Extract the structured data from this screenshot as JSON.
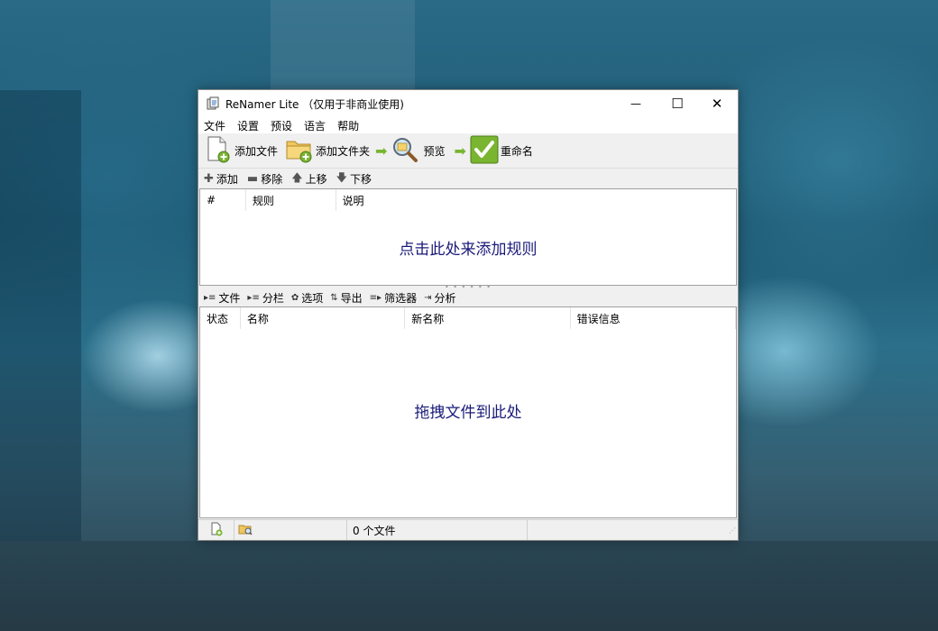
{
  "window": {
    "title": "ReNamer Lite （仅用于非商业使用)",
    "controls": {
      "minimize": "—",
      "maximize": "☐",
      "close": "✕"
    }
  },
  "menu": [
    "文件",
    "设置",
    "预设",
    "语言",
    "帮助"
  ],
  "toolbar": {
    "add_files": "添加文件",
    "add_folders": "添加文件夹",
    "preview": "预览",
    "rename": "重命名"
  },
  "rules_toolbar": {
    "add": "添加",
    "remove": "移除",
    "up": "上移",
    "down": "下移"
  },
  "rules_table": {
    "columns": [
      "#",
      "规则",
      "说明"
    ],
    "placeholder": "点击此处来添加规则"
  },
  "files_toolbar": [
    "文件",
    "分栏",
    "选项",
    "导出",
    "筛选器",
    "分析"
  ],
  "files_table": {
    "columns": [
      "状态",
      "名称",
      "新名称",
      "错误信息"
    ],
    "placeholder": "拖拽文件到此处"
  },
  "statusbar": {
    "file_count": "0 个文件"
  },
  "colors": {
    "accent_green": "#79b530",
    "placeholder_text": "#1a1a7a"
  }
}
